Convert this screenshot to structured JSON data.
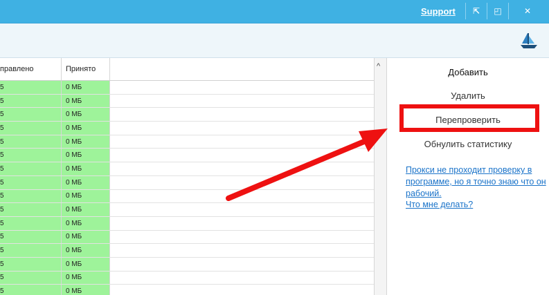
{
  "titlebar": {
    "support_label": "Support",
    "btn_restore": "⇱",
    "btn_max": "◰",
    "btn_close": "✕",
    "color": "#3fb1e3"
  },
  "toolbar": {
    "icon": "ship-icon"
  },
  "grid": {
    "columns": [
      "правлено",
      "Принято",
      ""
    ],
    "rows": [
      [
        "5",
        "0 МБ"
      ],
      [
        "5",
        "0 МБ"
      ],
      [
        "5",
        "0 МБ"
      ],
      [
        "5",
        "0 МБ"
      ],
      [
        "5",
        "0 МБ"
      ],
      [
        "5",
        "0 МБ"
      ],
      [
        "5",
        "0 МБ"
      ],
      [
        "5",
        "0 МБ"
      ],
      [
        "5",
        "0 МБ"
      ],
      [
        "5",
        "0 МБ"
      ],
      [
        "5",
        "0 МБ"
      ],
      [
        "5",
        "0 МБ"
      ],
      [
        "5",
        "0 МБ"
      ],
      [
        "5",
        "0 МБ"
      ],
      [
        "5",
        "0 МБ"
      ],
      [
        "5",
        "0 МБ"
      ]
    ],
    "row_color": "#9ef39a"
  },
  "scrollbar": {
    "up": "^"
  },
  "side": {
    "add": "Добавить",
    "delete": "Удалить",
    "recheck": "Перепроверить",
    "reset": "Обнулить статистику",
    "help_text": "Прокси не проходит проверку в программе, но я точно знаю что он рабочий.",
    "help_question": "Что мне делать?"
  },
  "annotation": {
    "color": "#ee1111"
  }
}
